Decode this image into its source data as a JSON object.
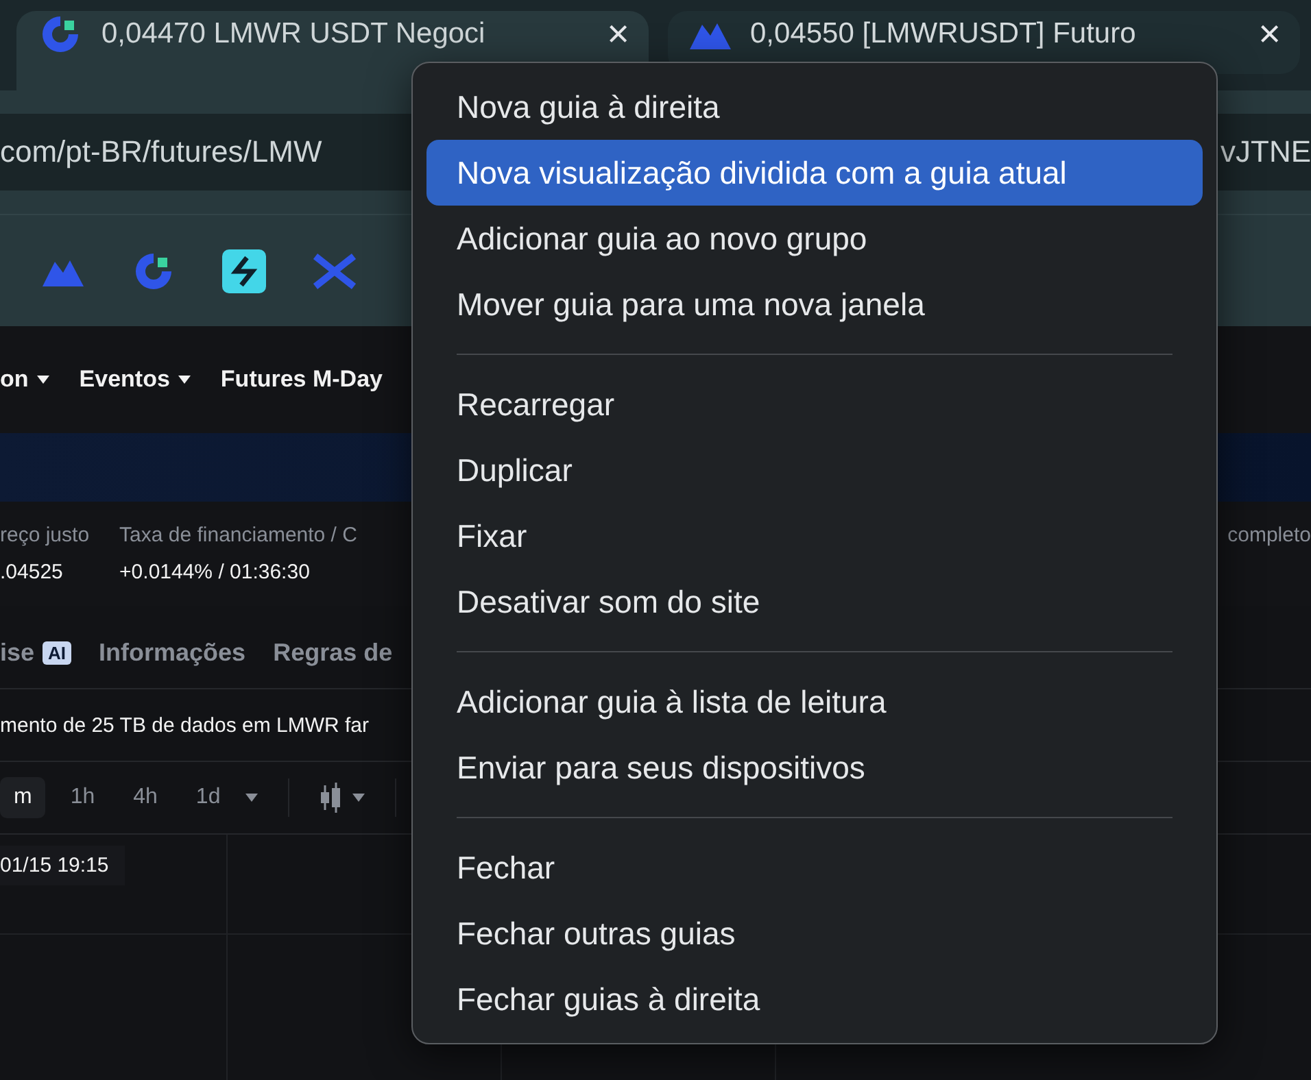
{
  "tabs": [
    {
      "title": "0,04470 LMWR USDT Negoci",
      "selected": true,
      "close": "×"
    },
    {
      "title": "0,04550 [LMWRUSDT] Futuro",
      "selected": false,
      "close": "×"
    }
  ],
  "address_bar": {
    "url_start": "com/pt-BR/futures/LMW",
    "url_end": "vJTNE"
  },
  "site": {
    "nav": [
      {
        "label": "on",
        "dropdown": true
      },
      {
        "label": "Eventos",
        "dropdown": true
      },
      {
        "label": "Futures M-Day",
        "dropdown": false
      }
    ],
    "stats": [
      {
        "label": "reço justo",
        "value": ".04525"
      },
      {
        "label": "Taxa de financiamento / C",
        "value": "+0.0144% / 01:36:30"
      }
    ],
    "stats_right_label": "completo",
    "section_tabs": [
      {
        "label": "ise",
        "badge": "AI"
      },
      {
        "label": "Informações"
      },
      {
        "label": "Regras de"
      }
    ],
    "news": "mento de 25 TB de dados em LMWR far",
    "intervals": [
      {
        "label": "m",
        "selected": true
      },
      {
        "label": "1h",
        "selected": false
      },
      {
        "label": "4h",
        "selected": false
      },
      {
        "label": "1d",
        "selected": false
      }
    ],
    "chart_time": "01/15 19:15"
  },
  "context_menu": {
    "groups": [
      [
        {
          "label": "Nova guia à direita",
          "selected": false
        },
        {
          "label": "Nova visualização dividida com a guia atual",
          "selected": true
        },
        {
          "label": "Adicionar guia ao novo grupo",
          "selected": false
        },
        {
          "label": "Mover guia para uma nova janela",
          "selected": false
        }
      ],
      [
        {
          "label": "Recarregar",
          "selected": false
        },
        {
          "label": "Duplicar",
          "selected": false
        },
        {
          "label": "Fixar",
          "selected": false
        },
        {
          "label": "Desativar som do site",
          "selected": false
        }
      ],
      [
        {
          "label": "Adicionar guia à lista de leitura",
          "selected": false
        },
        {
          "label": "Enviar para seus dispositivos",
          "selected": false
        }
      ],
      [
        {
          "label": "Fechar",
          "selected": false
        },
        {
          "label": "Fechar outras guias",
          "selected": false
        },
        {
          "label": "Fechar guias à direita",
          "selected": false
        }
      ]
    ]
  }
}
